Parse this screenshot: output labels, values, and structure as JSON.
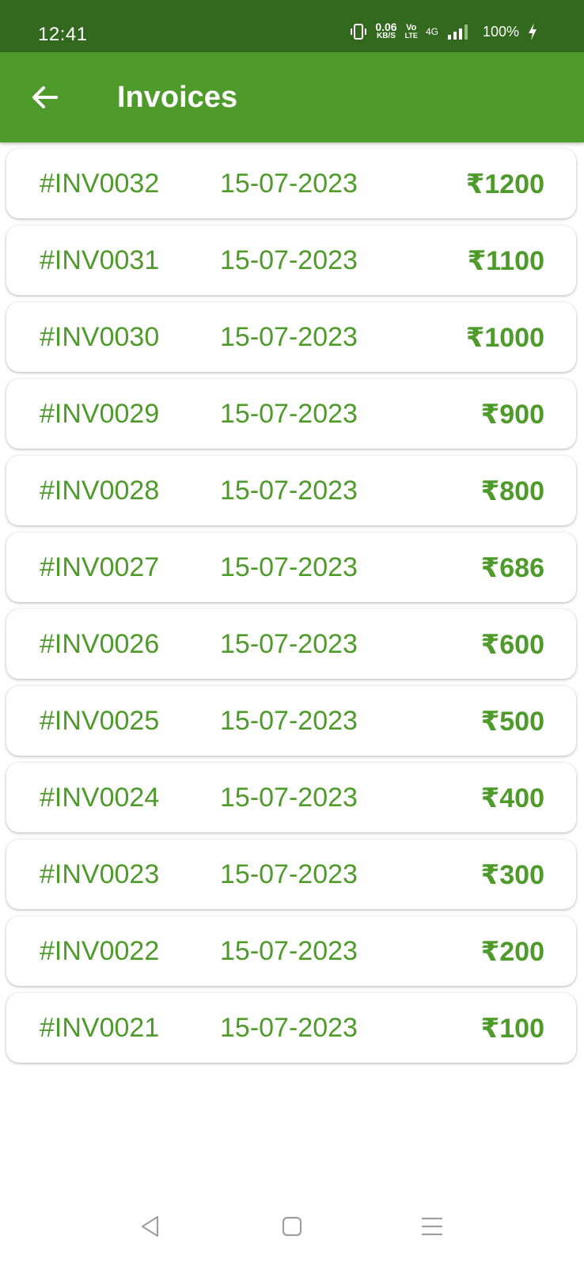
{
  "status_bar": {
    "time": "12:41",
    "net_speed_value": "0.06",
    "net_speed_unit": "KB/S",
    "volte_top": "Vo",
    "volte_bottom": "LTE",
    "network": "4G",
    "battery": "100%",
    "icons": [
      "vibrate-icon",
      "signal-icon",
      "charging-bolt-icon"
    ]
  },
  "app_bar": {
    "title": "Invoices",
    "back_icon": "arrow-left-icon"
  },
  "invoices": [
    {
      "id": "#INV0032",
      "date": "15-07-2023",
      "amount": "₹1200"
    },
    {
      "id": "#INV0031",
      "date": "15-07-2023",
      "amount": "₹1100"
    },
    {
      "id": "#INV0030",
      "date": "15-07-2023",
      "amount": "₹1000"
    },
    {
      "id": "#INV0029",
      "date": "15-07-2023",
      "amount": "₹900"
    },
    {
      "id": "#INV0028",
      "date": "15-07-2023",
      "amount": "₹800"
    },
    {
      "id": "#INV0027",
      "date": "15-07-2023",
      "amount": "₹686"
    },
    {
      "id": "#INV0026",
      "date": "15-07-2023",
      "amount": "₹600"
    },
    {
      "id": "#INV0025",
      "date": "15-07-2023",
      "amount": "₹500"
    },
    {
      "id": "#INV0024",
      "date": "15-07-2023",
      "amount": "₹400"
    },
    {
      "id": "#INV0023",
      "date": "15-07-2023",
      "amount": "₹300"
    },
    {
      "id": "#INV0022",
      "date": "15-07-2023",
      "amount": "₹200"
    },
    {
      "id": "#INV0021",
      "date": "15-07-2023",
      "amount": "₹100"
    }
  ],
  "nav_bar": {
    "icons": [
      "nav-back-icon",
      "nav-home-icon",
      "nav-menu-icon"
    ]
  },
  "colors": {
    "status_bar": "#33691e",
    "app_bar": "#4e9b2b",
    "text_accent": "#4e9b2b",
    "background": "#ffffff"
  }
}
